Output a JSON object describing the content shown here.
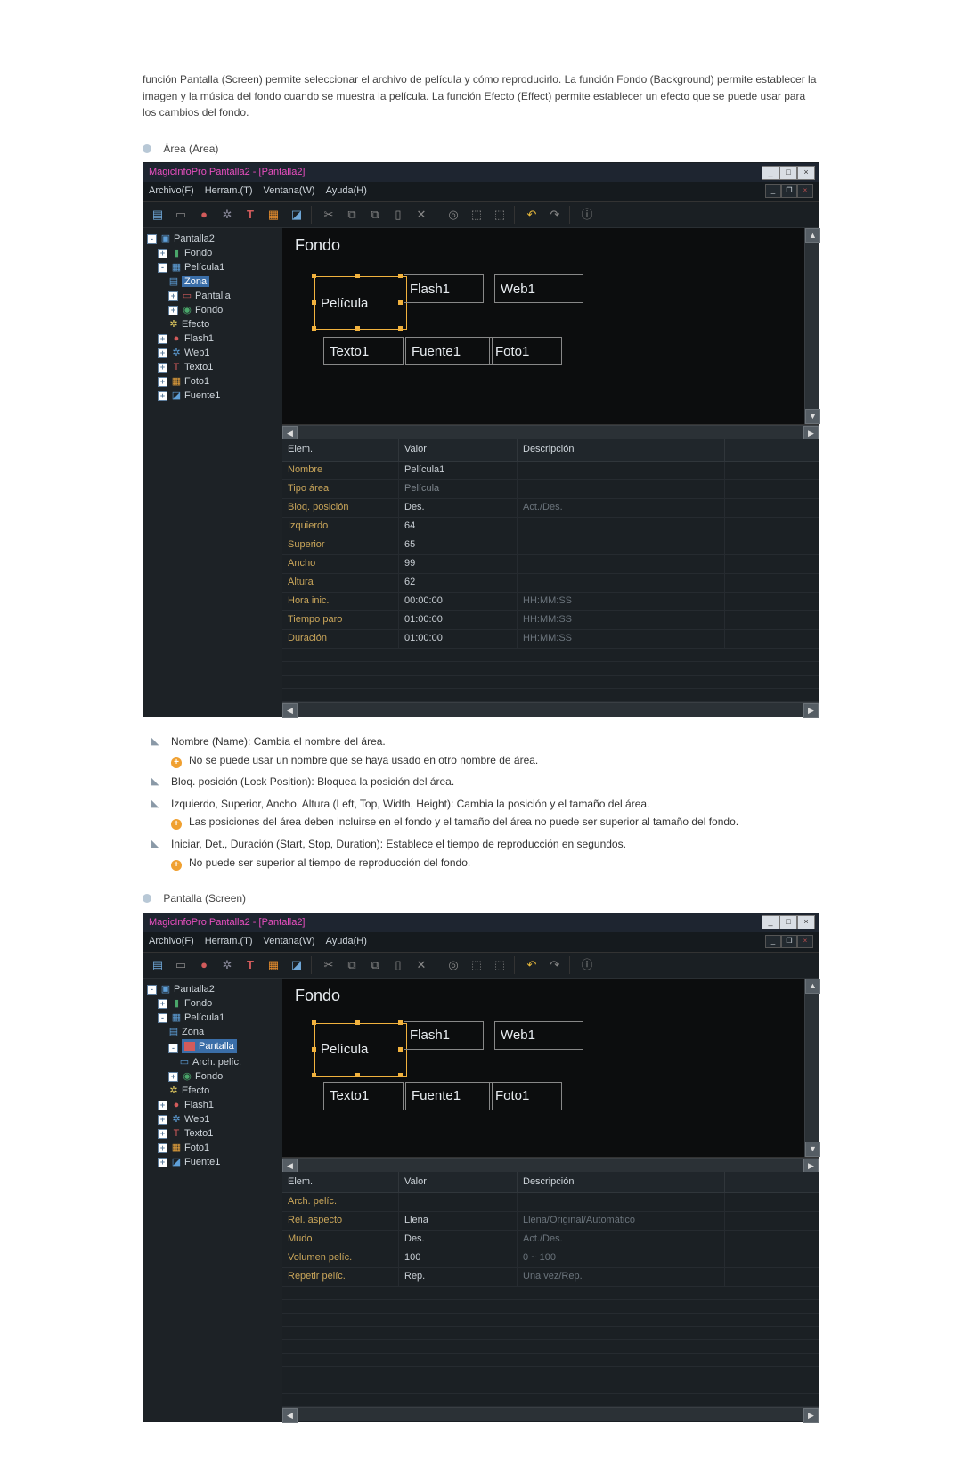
{
  "intro": "función Pantalla (Screen) permite seleccionar el archivo de película y cómo reproducirlo. La función Fondo (Background) permite establecer la imagen y la música del fondo cuando se muestra la película. La función Efecto (Effect) permite establecer un efecto que se puede usar para los cambios del fondo.",
  "section1": {
    "title": "Área (Area)"
  },
  "section2": {
    "title": "Pantalla (Screen)"
  },
  "app": {
    "title": "MagicInfoPro Pantalla2 - [Pantalla2]",
    "menu": {
      "m1": "Archivo(F)",
      "m2": "Herram.(T)",
      "m3": "Ventana(W)",
      "m4": "Ayuda(H)"
    }
  },
  "tree": {
    "pantalla2": "Pantalla2",
    "fondo": "Fondo",
    "pelicula1": "Película1",
    "zona": "Zona",
    "pantalla": "Pantalla",
    "arch": "Arch. pelíc.",
    "fondo2": "Fondo",
    "efecto": "Efecto",
    "flash1": "Flash1",
    "web1": "Web1",
    "texto1": "Texto1",
    "foto1": "Foto1",
    "fuente1": "Fuente1"
  },
  "canvas": {
    "fondo": "Fondo",
    "pelicula": "Película",
    "flash1": "Flash1",
    "web1": "Web1",
    "texto1": "Texto1",
    "fuente1": "Fuente1",
    "foto1": "Foto1"
  },
  "grid1": {
    "h1": "Elem.",
    "h2": "Valor",
    "h3": "Descripción",
    "rows": [
      {
        "k": "Nombre",
        "v": "Película1",
        "d": ""
      },
      {
        "k": "Tipo área",
        "v": "Película",
        "d": "",
        "dim": true
      },
      {
        "k": "Bloq. posición",
        "v": "Des.",
        "d": "Act./Des."
      },
      {
        "k": "Izquierdo",
        "v": "64",
        "d": ""
      },
      {
        "k": "Superior",
        "v": "65",
        "d": ""
      },
      {
        "k": "Ancho",
        "v": "99",
        "d": ""
      },
      {
        "k": "Altura",
        "v": "62",
        "d": ""
      },
      {
        "k": "Hora inic.",
        "v": "00:00:00",
        "d": "HH:MM:SS"
      },
      {
        "k": "Tiempo paro",
        "v": "01:00:00",
        "d": "HH:MM:SS"
      },
      {
        "k": "Duración",
        "v": "01:00:00",
        "d": "HH:MM:SS"
      }
    ]
  },
  "grid2": {
    "h1": "Elem.",
    "h2": "Valor",
    "h3": "Descripción",
    "rows": [
      {
        "k": "Arch. pelíc.",
        "v": "",
        "d": ""
      },
      {
        "k": "Rel. aspecto",
        "v": "Llena",
        "d": "Llena/Original/Automático"
      },
      {
        "k": "Mudo",
        "v": "Des.",
        "d": "Act./Des."
      },
      {
        "k": "Volumen pelíc.",
        "v": "100",
        "d": "0 ~ 100"
      },
      {
        "k": "Repetir pelíc.",
        "v": "Rep.",
        "d": "Una vez/Rep."
      }
    ]
  },
  "bullets": {
    "b1": "Nombre (Name): Cambia el nombre del área.",
    "b1n": "No se puede usar un nombre que se haya usado en otro nombre de área.",
    "b2": "Bloq. posición (Lock Position): Bloquea la posición del área.",
    "b3": "Izquierdo, Superior, Ancho, Altura (Left, Top, Width, Height): Cambia la posición y el tamaño del área.",
    "b3n": "Las posiciones del área deben incluirse en el fondo y el tamaño del área no puede ser superior al tamaño del fondo.",
    "b4": "Iniciar, Det., Duración (Start, Stop, Duration): Establece el tiempo de reproducción en segundos.",
    "b4n": "No puede ser superior al tiempo de reproducción del fondo."
  }
}
